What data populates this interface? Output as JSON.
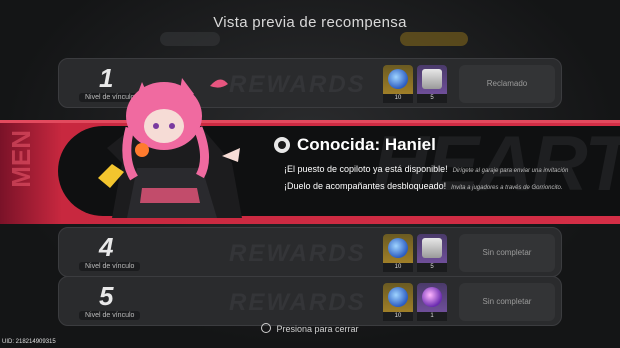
{
  "header": {
    "title": "Vista previa de recompensa"
  },
  "rows": [
    {
      "level": "1",
      "level_label": "Nivel de vínculo",
      "watermark": "REWARDS",
      "item1_qty": "10",
      "item2_qty": "5",
      "status": "Reclamado"
    },
    {
      "level": "4",
      "level_label": "Nivel de vínculo",
      "watermark": "REWARDS",
      "item1_qty": "10",
      "item2_qty": "5",
      "status": "Sin completar"
    },
    {
      "level": "5",
      "level_label": "Nivel de vínculo",
      "watermark": "REWARDS",
      "item1_qty": "10",
      "item2_qty": "1",
      "status": "Sin completar"
    }
  ],
  "banner": {
    "side_text": "MEN",
    "watermark": "HEART",
    "headline": "Conocida: Haniel",
    "messages": [
      {
        "main": "¡El puesto de copiloto ya está disponible!",
        "sub": "Dirígete al garaje para enviar una invitación"
      },
      {
        "main": "¡Duelo de acompañantes desbloqueado!",
        "sub": "Invita a jugadores a través de Gorrioncito."
      }
    ]
  },
  "footer": {
    "close_label": "Presiona para cerrar",
    "uid": "UID: 218214909315"
  },
  "colors": {
    "accent": "#d42e46",
    "background": "#151617",
    "hair": "#f06aa0"
  }
}
